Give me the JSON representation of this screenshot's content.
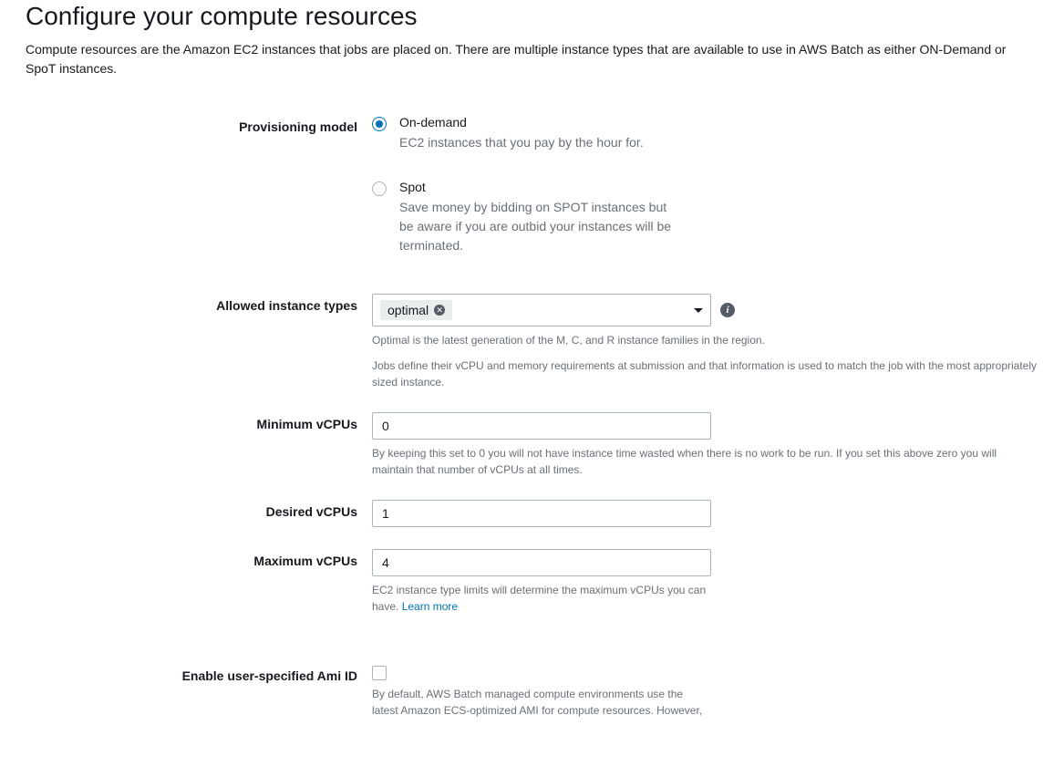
{
  "header": {
    "title": "Configure your compute resources",
    "intro": "Compute resources are the Amazon EC2 instances that jobs are placed on. There are multiple instance types that are available to use in AWS Batch as either ON-Demand or SpoT instances."
  },
  "provisioning": {
    "label": "Provisioning model",
    "options": [
      {
        "value": "on-demand",
        "label": "On-demand",
        "desc": "EC2 instances that you pay by the hour for.",
        "selected": true
      },
      {
        "value": "spot",
        "label": "Spot",
        "desc": "Save money by bidding on SPOT instances but be aware if you are outbid your instances will be terminated.",
        "selected": false
      }
    ]
  },
  "instance_types": {
    "label": "Allowed instance types",
    "selected_tag": "optimal",
    "help1": "Optimal is the latest generation of the M, C, and R instance families in the region.",
    "help2": "Jobs define their vCPU and memory requirements at submission and that information is used to match the job with the most appropriately sized instance."
  },
  "min_vcpus": {
    "label": "Minimum vCPUs",
    "value": "0",
    "help": "By keeping this set to 0 you will not have instance time wasted when there is no work to be run. If you set this above zero you will maintain that number of vCPUs at all times."
  },
  "desired_vcpus": {
    "label": "Desired vCPUs",
    "value": "1"
  },
  "max_vcpus": {
    "label": "Maximum vCPUs",
    "value": "4",
    "help": "EC2 instance type limits will determine the maximum vCPUs you can have. ",
    "learn_more": "Learn more"
  },
  "ami": {
    "label": "Enable user-specified Ami ID",
    "checked": false,
    "help": "By default, AWS Batch managed compute environments use the latest Amazon ECS-optimized AMI for compute resources. However,"
  }
}
